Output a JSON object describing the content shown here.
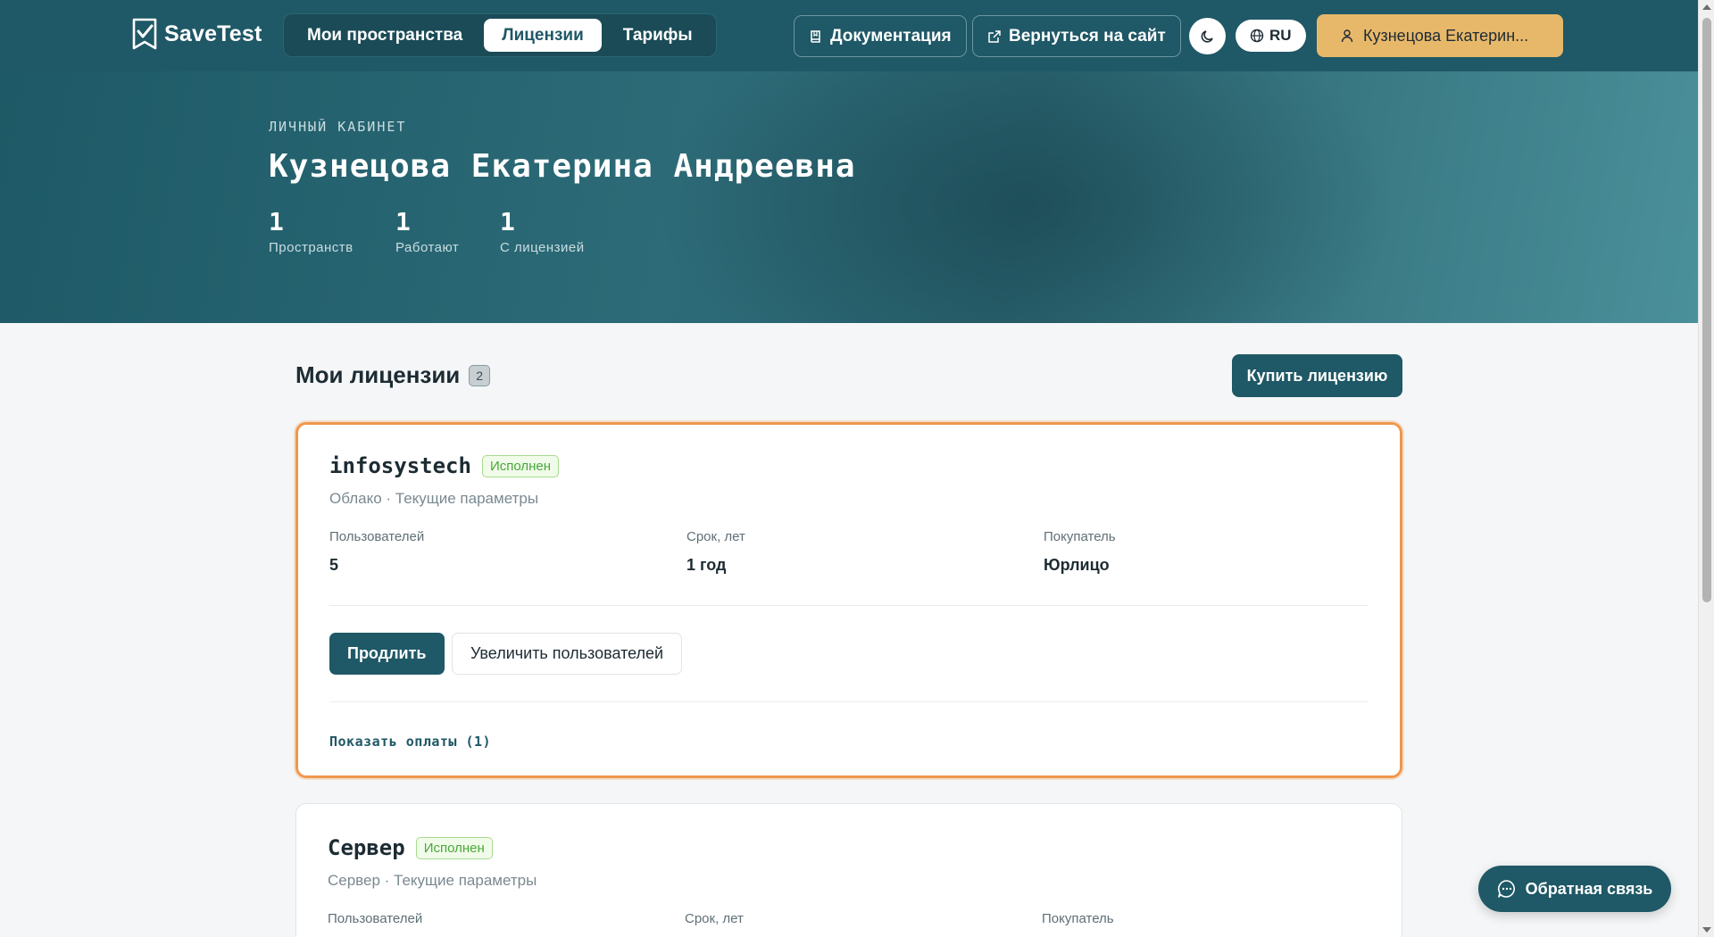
{
  "app": {
    "name": "SaveTest"
  },
  "nav": {
    "tabs": [
      {
        "label": "Мои пространства",
        "active": false
      },
      {
        "label": "Лицензии",
        "active": true
      },
      {
        "label": "Тарифы",
        "active": false
      }
    ]
  },
  "toolbar": {
    "docs_label": "Документация",
    "back_label": "Вернуться на сайт",
    "lang_label": "RU",
    "user_label": "Кузнецова Екатерин..."
  },
  "hero": {
    "label": "ЛИЧНЫЙ КАБИНЕТ",
    "title": "Кузнецова Екатерина Андреевна",
    "stats": [
      {
        "value": "1",
        "label": "Пространств"
      },
      {
        "value": "1",
        "label": "Работают"
      },
      {
        "value": "1",
        "label": "С лицензией"
      }
    ]
  },
  "licenses": {
    "title": "Мои лицензии",
    "count": "2",
    "buy_label": "Купить лицензию",
    "items": [
      {
        "name": "infosystech",
        "status": "Исполнен",
        "subtitle": "Облако · Текущие параметры",
        "fields": [
          {
            "label": "Пользователей",
            "value": "5"
          },
          {
            "label": "Срок, лет",
            "value": "1 год"
          },
          {
            "label": "Покупатель",
            "value": "Юрлицо"
          }
        ],
        "renew_label": "Продлить",
        "increase_label": "Увеличить пользователей",
        "payments_label": "Показать оплаты (1)"
      },
      {
        "name": "Сервер",
        "status": "Исполнен",
        "subtitle": "Сервер · Текущие параметры",
        "fields": [
          {
            "label": "Пользователей",
            "value": ""
          },
          {
            "label": "Срок, лет",
            "value": ""
          },
          {
            "label": "Покупатель",
            "value": ""
          }
        ]
      }
    ]
  },
  "feedback": {
    "label": "Обратная связь"
  },
  "colors": {
    "primary": "#1f5866",
    "accent": "#e8b86a",
    "highlight": "#f0974d",
    "success": "#47a83a"
  }
}
